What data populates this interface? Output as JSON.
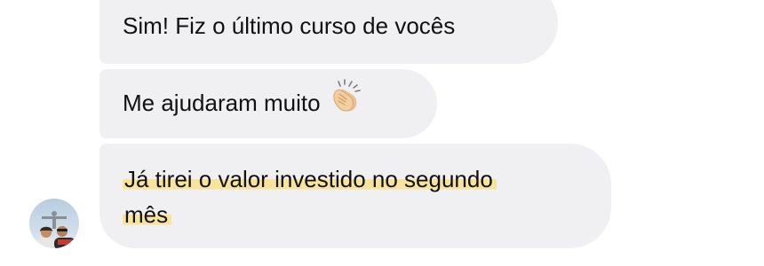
{
  "messages": [
    {
      "text": "Sim! Fiz o último curso de vocês"
    },
    {
      "text": "Me ajudaram muito",
      "emoji": "clapping-hands-icon"
    },
    {
      "line1": "Já tirei o valor investido no segundo",
      "line2": "mês",
      "highlight_color": "#f7e39a"
    }
  ],
  "colors": {
    "bubble": "#f0f0f2",
    "text": "#111111",
    "background": "#ffffff"
  }
}
